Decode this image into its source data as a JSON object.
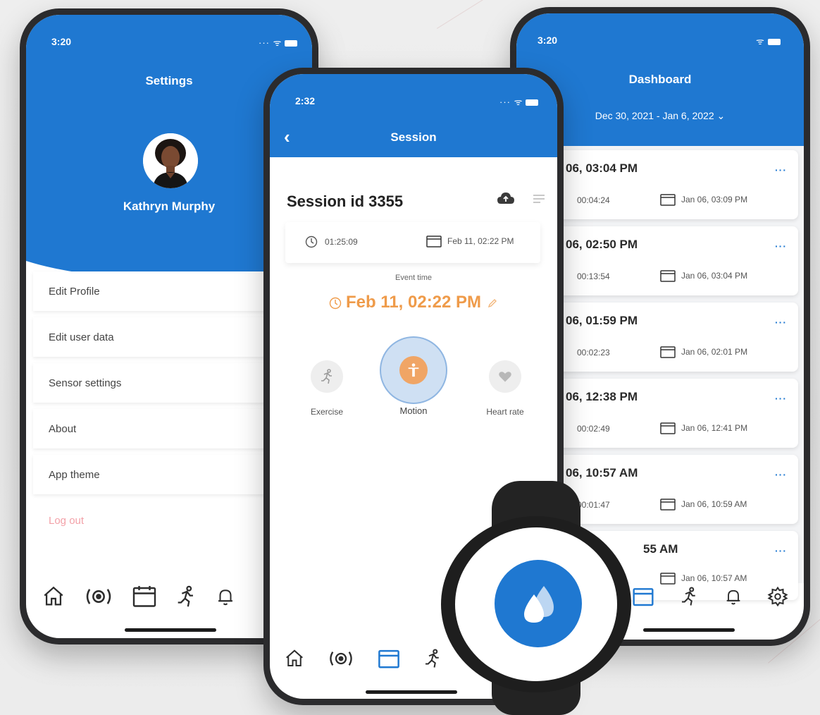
{
  "colors": {
    "primary": "#1f78d1",
    "accent": "#ef9b4a",
    "danger": "#f3a1a8",
    "frame": "#2b2b2d"
  },
  "settings_screen": {
    "status_time": "3:20",
    "title": "Settings",
    "user_name": "Kathryn Murphy",
    "menu": [
      {
        "label": "Edit Profile"
      },
      {
        "label": "Edit user data"
      },
      {
        "label": "Sensor settings"
      },
      {
        "label": "About"
      },
      {
        "label": "App theme"
      },
      {
        "label": "Log out"
      }
    ],
    "nav_icons": [
      "home-icon",
      "sensor-icon",
      "calendar-icon",
      "running-icon",
      "bell-icon"
    ]
  },
  "dashboard_screen": {
    "status_time": "3:20",
    "title": "Dashboard",
    "date_range": "Dec 30, 2021 - Jan 6, 2022 ⌄",
    "more_label": "···",
    "sessions": [
      {
        "start": "06, 03:04 PM",
        "duration": "00:04:24",
        "end": "Jan 06, 03:09 PM"
      },
      {
        "start": "06, 02:50 PM",
        "duration": "00:13:54",
        "end": "Jan 06, 03:04 PM"
      },
      {
        "start": "06, 01:59 PM",
        "duration": "00:02:23",
        "end": "Jan 06, 02:01 PM"
      },
      {
        "start": "06, 12:38 PM",
        "duration": "00:02:49",
        "end": "Jan 06, 12:41 PM"
      },
      {
        "start": "06, 10:57 AM",
        "duration": "00:01:47",
        "end": "Jan 06, 10:59 AM"
      },
      {
        "start": "55 AM",
        "duration": "",
        "end": "Jan 06, 10:57 AM"
      }
    ],
    "nav_icons": [
      "calendar-icon",
      "running-icon",
      "bell-icon",
      "gear-icon"
    ]
  },
  "session_screen": {
    "status_time": "2:32",
    "title": "Session",
    "session_id": "Session id 3355",
    "duration": "01:25:09",
    "date": "Feb 11, 02:22 PM",
    "event_label": "Event time",
    "event_time": "Feb 11, 02:22 PM",
    "modes": [
      {
        "label": "Exercise",
        "icon": "running-icon"
      },
      {
        "label": "Motion",
        "icon": "person-icon",
        "selected": true
      },
      {
        "label": "Heart rate",
        "icon": "heart-icon"
      }
    ],
    "nav_icons": [
      "home-icon",
      "sensor-icon",
      "calendar-icon",
      "running-icon"
    ]
  },
  "watch": {
    "icon": "water-drop-icon"
  }
}
